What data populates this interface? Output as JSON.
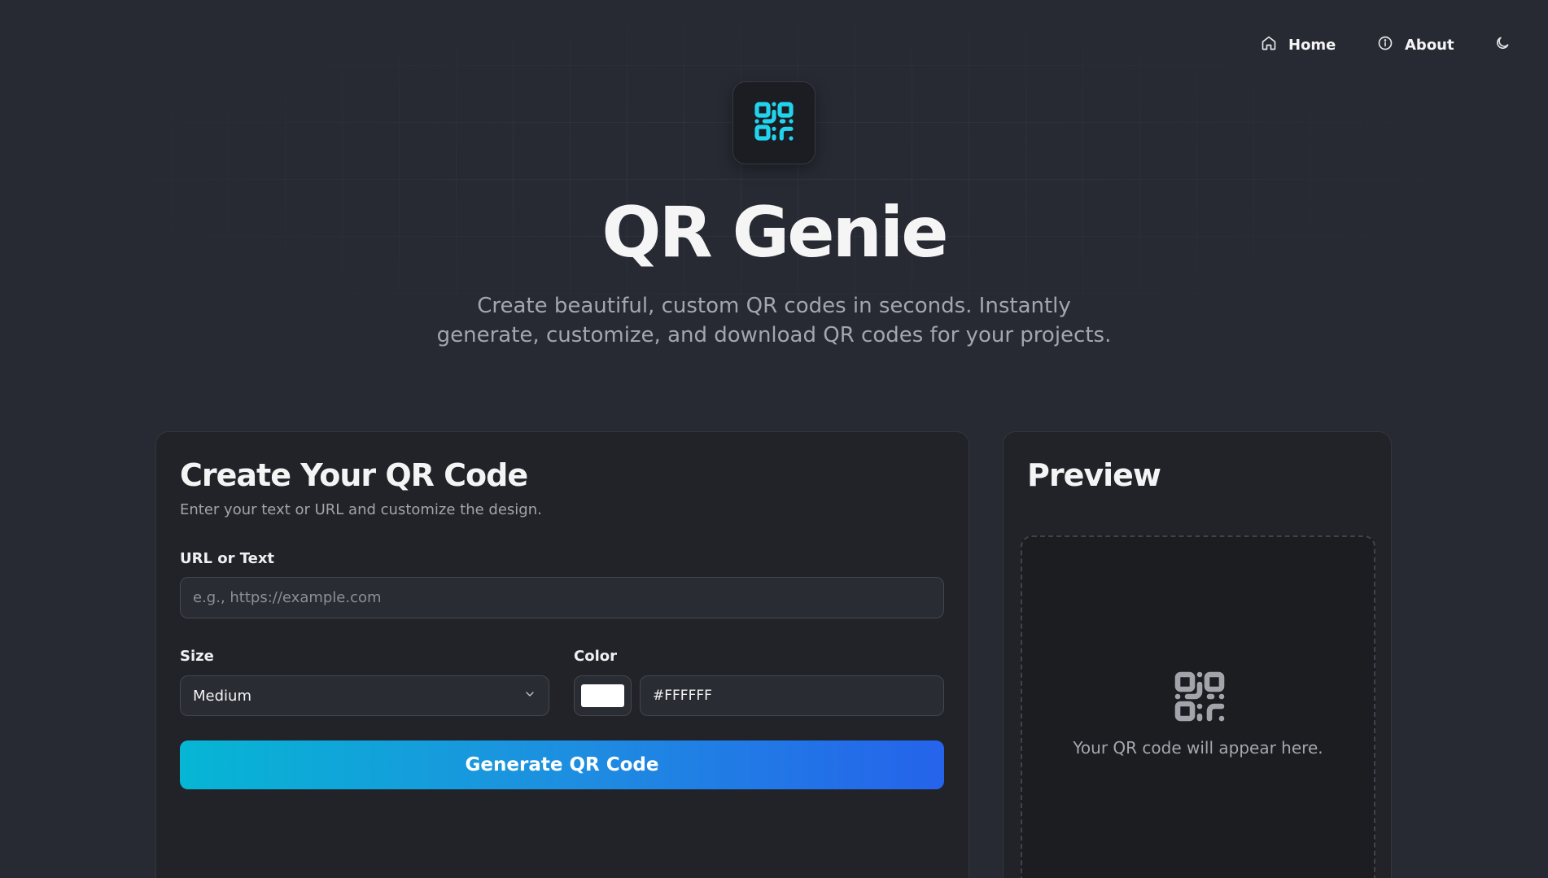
{
  "nav": {
    "home_label": "Home",
    "about_label": "About"
  },
  "hero": {
    "title": "QR Genie",
    "subtitle": "Create beautiful, custom QR codes in seconds. Instantly generate, customize, and download QR codes for your projects."
  },
  "create": {
    "title": "Create Your QR Code",
    "description": "Enter your text or URL and customize the design.",
    "url_label": "URL or Text",
    "url_placeholder": "e.g., https://example.com",
    "url_value": "",
    "size_label": "Size",
    "size_value": "Medium",
    "color_label": "Color",
    "color_value": "#FFFFFF",
    "generate_label": "Generate QR Code"
  },
  "preview": {
    "title": "Preview",
    "empty_text": "Your QR code will appear here."
  },
  "colors": {
    "accent_cyan": "#22d3ee",
    "gradient_start": "#06b6d4",
    "gradient_end": "#2563eb",
    "background": "#272a33",
    "card": "#212329"
  },
  "icons": {
    "nav_home": "home-icon",
    "nav_about": "info-icon",
    "nav_theme": "moon-icon",
    "logo": "qr-code-icon",
    "select": "chevron-down-icon",
    "preview": "qr-code-icon"
  }
}
